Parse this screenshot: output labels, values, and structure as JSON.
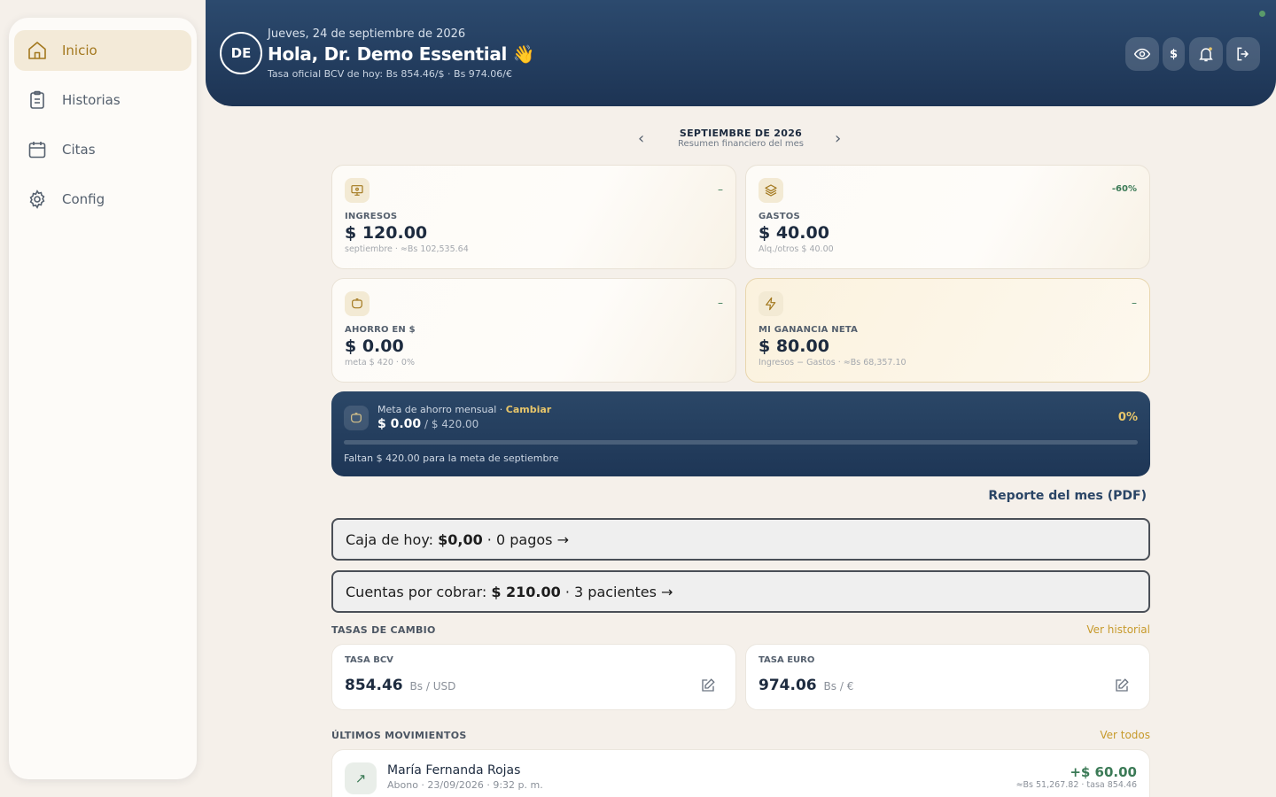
{
  "sidebar": {
    "items": [
      {
        "label": "Inicio",
        "icon": "home-icon",
        "active": true
      },
      {
        "label": "Historias",
        "icon": "clipboard-icon",
        "active": false
      },
      {
        "label": "Citas",
        "icon": "calendar-icon",
        "active": false
      },
      {
        "label": "Config",
        "icon": "gear-icon",
        "active": false
      }
    ]
  },
  "header": {
    "avatar_initials": "DE",
    "date": "Jueves, 24 de septiembre de 2026",
    "greeting": "Hola, Dr. Demo Essential 👋",
    "rate_line": "Tasa oficial BCV de hoy: Bs 854.46/$ · Bs 974.06/€",
    "currency_button": "$",
    "buttons": [
      "eye-icon",
      "currency-button",
      "bell-icon",
      "logout-icon"
    ],
    "colors": {
      "background": "#1d3454",
      "accent": "#e8c66a"
    }
  },
  "month_nav": {
    "title": "SEPTIEMBRE DE 2026",
    "subtitle": "Resumen financiero del mes",
    "prev": "‹",
    "next": "›"
  },
  "stats": {
    "ingresos": {
      "label": "INGRESOS",
      "value": "$ 120.00",
      "note": "septiembre · ≈Bs 102,535.64",
      "trend": "–",
      "icon": "monitor-icon"
    },
    "gastos": {
      "label": "GASTOS",
      "value": "$ 40.00",
      "note": "Alq./otros $ 40.00",
      "trend": "-60%",
      "icon": "layers-icon"
    },
    "ahorro": {
      "label": "AHORRO EN $",
      "value": "$ 0.00",
      "note": "meta $ 420 · 0%",
      "trend": "–",
      "icon": "piggy-bank-icon"
    },
    "ganancia": {
      "label": "MI GANANCIA NETA",
      "value": "$ 80.00",
      "note": "Ingresos − Gastos · ≈Bs 68,357.10",
      "trend": "–",
      "icon": "lightning-icon"
    }
  },
  "goal": {
    "title": "Meta de ahorro mensual · ",
    "change_link": "Cambiar",
    "current": "$ 0.00",
    "target": " / $ 420.00",
    "percent_label": "0%",
    "progress": 0,
    "footer": "Faltan $ 420.00 para la meta de septiembre"
  },
  "report_link": "Reporte del mes (PDF)",
  "cash_today": {
    "prefix": "Caja de hoy: ",
    "amount": "$0,00",
    "suffix": " · 0 pagos →"
  },
  "receivables": {
    "prefix": "Cuentas por cobrar: ",
    "amount": "$ 210.00",
    "suffix": " · 3 pacientes →"
  },
  "exchange": {
    "title": "TASAS DE CAMBIO",
    "link": "Ver historial",
    "bcv": {
      "label": "TASA BCV",
      "value": "854.46",
      "unit": "Bs / USD"
    },
    "euro": {
      "label": "TASA EURO",
      "value": "974.06",
      "unit": "Bs / €"
    }
  },
  "movements": {
    "title": "ÚLTIMOS MOVIMIENTOS",
    "link": "Ver todos",
    "items": [
      {
        "name": "María Fernanda Rojas",
        "detail": "Abono · 23/09/2026 · 9:32 p. m.",
        "amount": "+$ 60.00",
        "conversion": "≈Bs 51,267.82 · tasa 854.46",
        "icon": "arrow-up-right-icon"
      }
    ]
  }
}
